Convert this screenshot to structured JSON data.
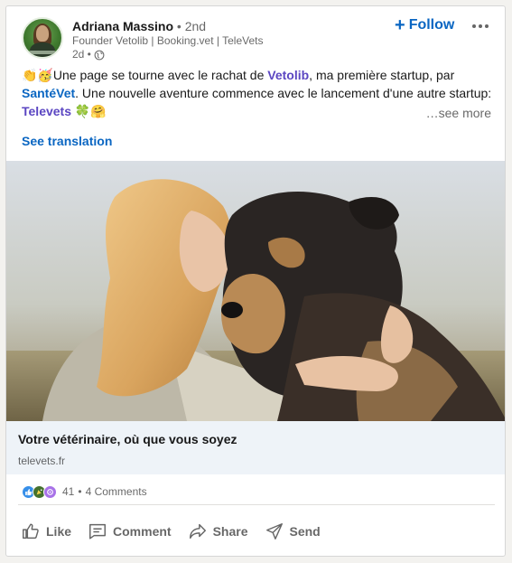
{
  "author": {
    "name": "Adriana Massino",
    "degree": "• 2nd",
    "headline": "Founder Vetolib | Booking.vet | TeleVets",
    "time": "2d •"
  },
  "header_actions": {
    "follow_label": "Follow",
    "follow_icon": "+"
  },
  "post": {
    "lead_emoji": "👏🥳",
    "text_1": "Une page se tourne avec le rachat de ",
    "hashtag_1": "Vetolib",
    "text_2": ", ma première startup, par ",
    "mention_1": "SantéVet",
    "text_3": ". Une nouvelle aventure commence avec le lancement d'une autre startup: ",
    "hashtag_2": "Televets",
    "trail_emoji": " 🍀🤗",
    "see_more": "…see more",
    "see_translation": "See translation"
  },
  "link_preview": {
    "title": "Votre vétérinaire, où que vous soyez",
    "domain": "televets.fr"
  },
  "social": {
    "reactions_count": "41",
    "separator": "•",
    "comments": "4 Comments",
    "reaction_icons": [
      "like-icon",
      "celebrate-icon",
      "curious-icon"
    ]
  },
  "actions": {
    "like": "Like",
    "comment": "Comment",
    "share": "Share",
    "send": "Send"
  },
  "colors": {
    "link_blue": "#0a66c2",
    "hashtag_purple": "#5b46c2",
    "preview_bg": "#eef3f8"
  }
}
